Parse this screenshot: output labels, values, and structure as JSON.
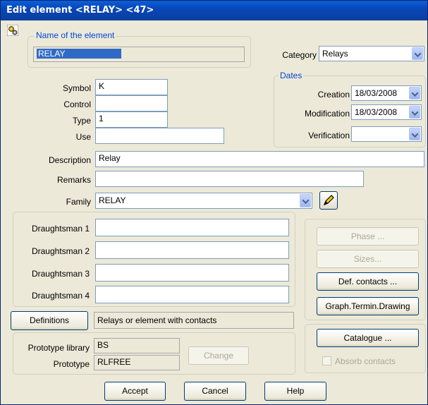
{
  "window": {
    "title": "Edit element <RELAY> <47>"
  },
  "name_group": {
    "legend": "Name of the element",
    "value": "RELAY"
  },
  "category": {
    "label": "Category",
    "value": "Relays"
  },
  "dates": {
    "legend": "Dates",
    "creation_label": "Creation",
    "creation_value": "18/03/2008",
    "modification_label": "Modification",
    "modification_value": "18/03/2008",
    "verification_label": "Verification",
    "verification_value": ""
  },
  "fields": {
    "symbol_label": "Symbol",
    "symbol_value": "K",
    "control_label": "Control",
    "control_value": "",
    "type_label": "Type",
    "type_value": "1",
    "use_label": "Use",
    "use_value": "",
    "description_label": "Description",
    "description_value": "Relay",
    "remarks_label": "Remarks",
    "remarks_value": "",
    "family_label": "Family",
    "family_value": "RELAY"
  },
  "draughtsmen": [
    {
      "label": "Draughtsman 1",
      "value": ""
    },
    {
      "label": "Draughtsman 2",
      "value": ""
    },
    {
      "label": "Draughtsman 3",
      "value": ""
    },
    {
      "label": "Draughtsman 4",
      "value": ""
    }
  ],
  "definitions": {
    "button": "Definitions",
    "value": "Relays or element with contacts"
  },
  "prototype": {
    "library_label": "Prototype library",
    "library_value": "BS",
    "prototype_label": "Prototype",
    "prototype_value": "RLFREE",
    "change_button": "Change"
  },
  "side_buttons": {
    "phase": "Phase ...",
    "sizes": "Sizes...",
    "def_contacts": "Def. contacts ...",
    "graph_termin": "Graph.Termin.Drawing",
    "catalogue": "Catalogue ...",
    "absorb_contacts": "Absorb contacts"
  },
  "footer": {
    "accept": "Accept",
    "cancel": "Cancel",
    "help": "Help"
  }
}
